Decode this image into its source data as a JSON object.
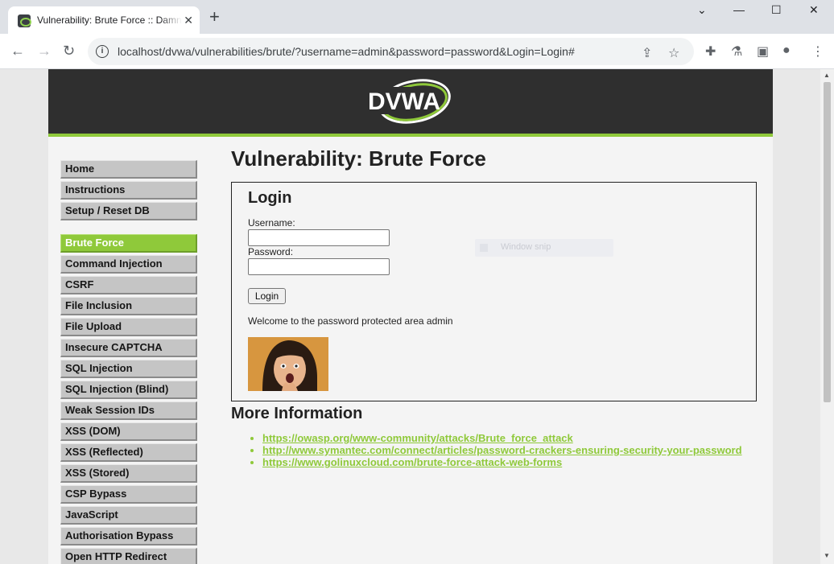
{
  "browser": {
    "tab_title": "Vulnerability: Brute Force :: Damn Vulnerable Web Application (DVWA)",
    "tab_close": "✕",
    "new_tab": "+",
    "url": "localhost/dvwa/vulnerabilities/brute/?username=admin&password=password&Login=Login#",
    "window_controls": [
      "⌄",
      "—",
      "☐",
      "✕"
    ]
  },
  "header": {
    "logo_text": "DVWA"
  },
  "menu": {
    "group1": [
      "Home",
      "Instructions",
      "Setup / Reset DB"
    ],
    "group2": [
      "Brute Force",
      "Command Injection",
      "CSRF",
      "File Inclusion",
      "File Upload",
      "Insecure CAPTCHA",
      "SQL Injection",
      "SQL Injection (Blind)",
      "Weak Session IDs",
      "XSS (DOM)",
      "XSS (Reflected)",
      "XSS (Stored)",
      "CSP Bypass",
      "JavaScript",
      "Authorisation Bypass",
      "Open HTTP Redirect"
    ],
    "active": "Brute Force"
  },
  "main": {
    "title": "Vulnerability: Brute Force",
    "login_heading": "Login",
    "username_label": "Username:",
    "username_value": "",
    "password_label": "Password:",
    "password_value": "",
    "login_button": "Login",
    "welcome": "Welcome to the password protected area admin",
    "ghost_text": "Window snip",
    "more_info_heading": "More Information",
    "links": [
      "https://owasp.org/www-community/attacks/Brute_force_attack",
      "http://www.symantec.com/connect/articles/password-crackers-ensuring-security-your-password",
      "https://www.golinuxcloud.com/brute-force-attack-web-forms"
    ]
  },
  "colors": {
    "accent": "#8fc93a",
    "header_bg": "#2f2f2f"
  }
}
